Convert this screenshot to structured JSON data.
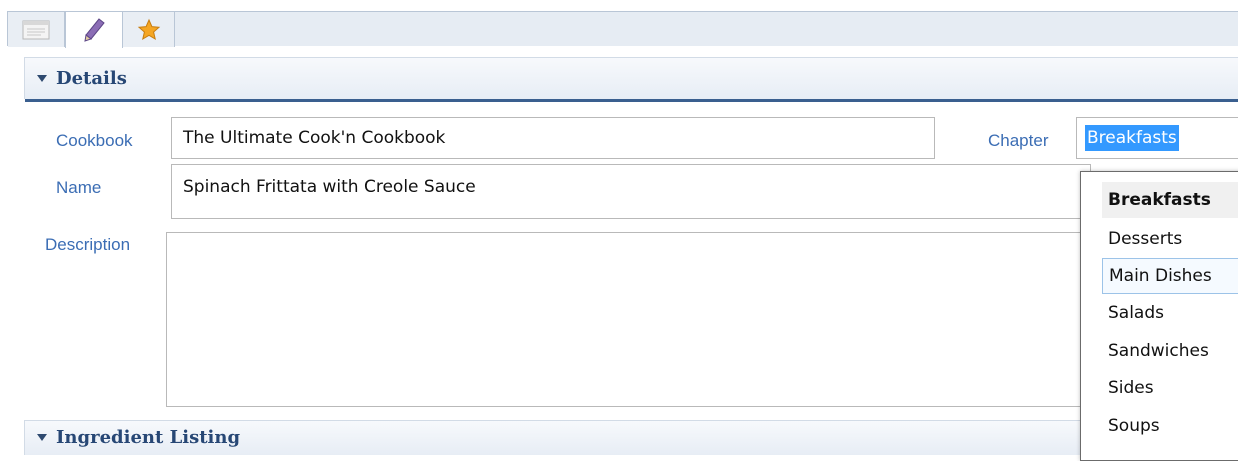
{
  "tabs": [
    {
      "icon": "document-icon"
    },
    {
      "icon": "pencil-icon"
    },
    {
      "icon": "star-icon"
    }
  ],
  "details": {
    "title": "Details",
    "cookbook_label": "Cookbook",
    "cookbook_value": "The Ultimate Cook'n Cookbook",
    "name_label": "Name",
    "name_value": "Spinach Frittata with Creole Sauce",
    "description_label": "Description",
    "description_value": "",
    "chapter_label": "Chapter",
    "chapter_value": "Breakfasts"
  },
  "chapter_options": [
    "Breakfasts",
    "Desserts",
    "Main Dishes",
    "Salads",
    "Sandwiches",
    "Sides",
    "Soups"
  ],
  "ingredients": {
    "title": "Ingredient Listing"
  },
  "colors": {
    "label": "#3b6db4",
    "section_title": "#274775",
    "selection": "#3399ff",
    "star": "#f5a623"
  }
}
